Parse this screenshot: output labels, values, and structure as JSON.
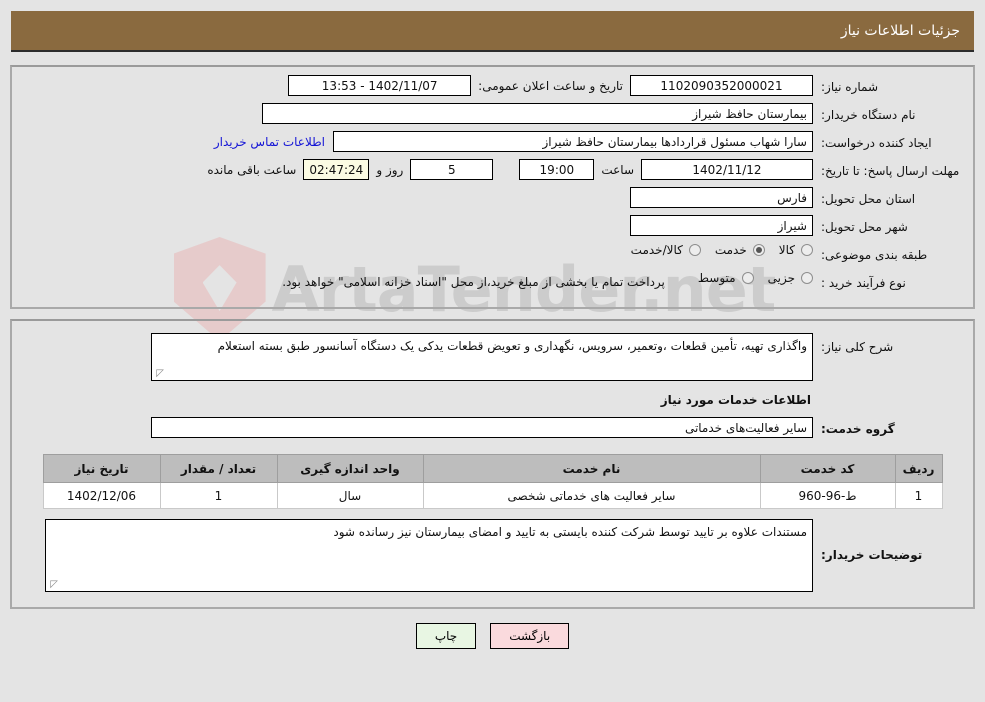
{
  "header": {
    "title": "جزئیات اطلاعات نیاز",
    "bg_color": "#8a6a3f"
  },
  "watermark": {
    "text": "ArtaTender.net"
  },
  "basic_info": {
    "need_number_label": "شماره نیاز:",
    "need_number_value": "1102090352000021",
    "announce_datetime_label": "تاریخ و ساعت اعلان عمومی:",
    "announce_datetime_value": "1402/11/07 - 13:53",
    "buyer_org_label": "نام دستگاه خریدار:",
    "buyer_org_value": "بیمارستان حافظ شیراز",
    "creator_label": "ایجاد کننده درخواست:",
    "creator_value": "سارا شهاب مسئول قراردادها بیمارستان حافظ شیراز",
    "contact_link": "اطلاعات تماس خریدار",
    "deadline_label": "مهلت ارسال پاسخ: تا تاریخ:",
    "deadline_date": "1402/11/12",
    "deadline_time_label": "ساعت",
    "deadline_time": "19:00",
    "remaining_days": "5",
    "remaining_days_label": "روز و",
    "remaining_clock": "02:47:24",
    "remaining_clock_label": "ساعت باقی مانده",
    "province_label": "استان محل تحویل:",
    "province_value": "فارس",
    "city_label": "شهر محل تحویل:",
    "city_value": "شیراز"
  },
  "classification": {
    "label": "طبقه بندی موضوعی:",
    "options": [
      {
        "text": "کالا",
        "selected": false
      },
      {
        "text": "خدمت",
        "selected": true
      },
      {
        "text": "کالا/خدمت",
        "selected": false
      }
    ]
  },
  "purchase_type": {
    "label": "نوع فرآیند خرید :",
    "options": [
      {
        "text": "جزیی",
        "selected": false
      },
      {
        "text": "متوسط",
        "selected": false
      }
    ],
    "note": "پرداخت تمام یا بخشی از مبلغ خرید،از محل \"اسناد خزانه اسلامی\" خواهد بود."
  },
  "general_description": {
    "label": "شرح کلی نیاز:",
    "value": "واگذاری تهیه، تأمین قطعات ،وتعمیر، سرویس، نگهداری و تعویض قطعات یدکی یک  دستگاه آسانسور طبق بسته استعلام"
  },
  "services_section": {
    "heading": "اطلاعات خدمات مورد نیاز",
    "group_label": "گروه خدمت:",
    "group_value": "سایر فعالیت‌های خدماتی"
  },
  "items_table": {
    "columns": [
      "ردیف",
      "کد خدمت",
      "نام خدمت",
      "واحد اندازه گیری",
      "تعداد / مقدار",
      "تاریخ نیاز"
    ],
    "rows": [
      {
        "index": "1",
        "code": "ط-96-960",
        "name": "سایر فعالیت های خدماتی شخصی",
        "unit": "سال",
        "quantity": "1",
        "need_date": "1402/12/06"
      }
    ]
  },
  "buyer_notes": {
    "label": "توضیحات خریدار:",
    "value": "مستندات علاوه بر تایید توسط شرکت کننده بایستی به تایید و امضای بیمارستان نیز رسانده شود"
  },
  "footer": {
    "back_button": "بازگشت",
    "print_button": "چاپ"
  }
}
